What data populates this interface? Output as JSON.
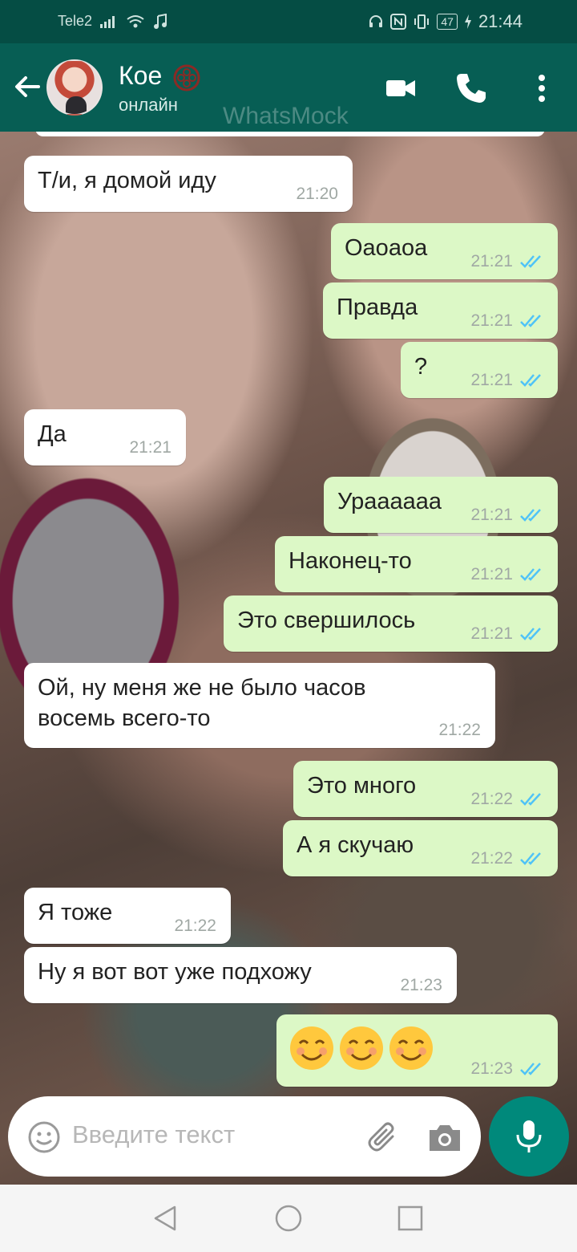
{
  "status_bar": {
    "carrier": "Tele2",
    "battery": "47",
    "time": "21:44"
  },
  "header": {
    "contact_name": "Кое",
    "contact_status": "онлайн",
    "watermark": "WhatsMock",
    "icons": [
      "back-arrow-icon",
      "video-call-icon",
      "phone-call-icon",
      "more-options-icon"
    ]
  },
  "messages": [
    {
      "dir": "in",
      "text": "Т/и, я домой иду",
      "time": "21:20"
    },
    {
      "dir": "out",
      "text": "Оаоаоа",
      "time": "21:21"
    },
    {
      "dir": "out",
      "text": "Правда",
      "time": "21:21"
    },
    {
      "dir": "out",
      "text": "?",
      "time": "21:21"
    },
    {
      "dir": "in",
      "text": "Да",
      "time": "21:21"
    },
    {
      "dir": "out",
      "text": "Ураааааа",
      "time": "21:21"
    },
    {
      "dir": "out",
      "text": "Наконец-то",
      "time": "21:21"
    },
    {
      "dir": "out",
      "text": "Это свершилось",
      "time": "21:21"
    },
    {
      "dir": "in",
      "text": "Ой, ну меня же не было часов\nвосемь всего-то",
      "time": "21:22"
    },
    {
      "dir": "out",
      "text": "Это много",
      "time": "21:22"
    },
    {
      "dir": "out",
      "text": "А я скучаю",
      "time": "21:22"
    },
    {
      "dir": "in",
      "text": "Я тоже",
      "time": "21:22"
    },
    {
      "dir": "in",
      "text": "Ну я вот вот уже подхожу",
      "time": "21:23"
    },
    {
      "dir": "out",
      "text": "😊😊😊",
      "time": "21:23"
    }
  ],
  "input": {
    "placeholder": "Введите текст"
  },
  "colors": {
    "header": "#075e54",
    "status_bar": "#054d44",
    "outgoing_bubble": "#dcf8c6",
    "incoming_bubble": "#ffffff",
    "read_ticks": "#4fc3f7",
    "mic_button": "#00897b"
  }
}
